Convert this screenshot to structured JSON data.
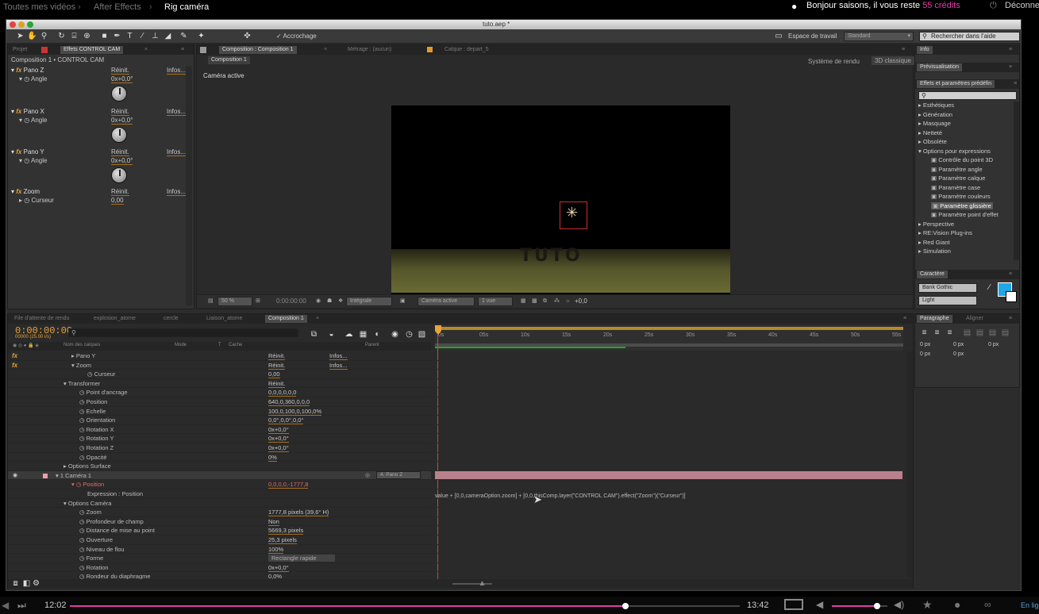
{
  "site": {
    "crumbs": [
      "Toutes mes vidéos",
      "After Effects",
      "Rig caméra"
    ],
    "greeting": "Bonjour saisons, il vous reste",
    "credits": "55 crédits",
    "disconnect": "Déconne"
  },
  "window": {
    "title": "tuto.aep *"
  },
  "toolbar": {
    "snap_label": "Accrochage",
    "workspace_label": "Espace de travail",
    "workspace_value": "Standard",
    "help_search": "Rechercher dans l'aide"
  },
  "left_panel": {
    "tabs": [
      "Projet",
      "Effets CONTROL CAM",
      "Métrage : (aucun)"
    ],
    "header": "Composition 1 • CONTROL CAM",
    "reset": "Réinit.",
    "about": "Infos...",
    "effects": [
      {
        "name": "Pano Z",
        "param": "Angle",
        "value": "0x+0,0°"
      },
      {
        "name": "Pano X",
        "param": "Angle",
        "value": "0x+0,0°"
      },
      {
        "name": "Pano Y",
        "param": "Angle",
        "value": "0x+0,0°"
      },
      {
        "name": "Zoom",
        "param": "Curseur",
        "value": "0,00"
      }
    ]
  },
  "comp_panel": {
    "tab": "Composition : Composition 1",
    "tab_metrage": "Métrage : (aucun)",
    "tab_calque": "Calque : depart_5",
    "subtab": "Composition 1",
    "renderer_label": "Système de rendu",
    "renderer_value": "3D classique",
    "active_cam": "Caméra active",
    "tuto_text": "TUTO",
    "zoom_value": "50 %",
    "timecode": "0:00:00:00",
    "resolution": "Intégrale",
    "camera": "Caméra active",
    "views": "1 vue",
    "exposure": "+0,0"
  },
  "right_panel": {
    "info_tab": "Info",
    "preview_tab": "Prévisualisation",
    "effects_tab": "Effets et paramètres prédéfin",
    "effects_list": [
      {
        "label": "Esthétiques",
        "level": 0
      },
      {
        "label": "Génération",
        "level": 0
      },
      {
        "label": "Masquage",
        "level": 0
      },
      {
        "label": "Netteté",
        "level": 0
      },
      {
        "label": "Obsolète",
        "level": 0
      },
      {
        "label": "Options pour expressions",
        "level": 0,
        "open": true
      },
      {
        "label": "Contrôle du point 3D",
        "level": 1
      },
      {
        "label": "Paramètre angle",
        "level": 1
      },
      {
        "label": "Paramètre calque",
        "level": 1
      },
      {
        "label": "Paramètre case",
        "level": 1
      },
      {
        "label": "Paramètre couleurs",
        "level": 1
      },
      {
        "label": "Paramètre glissière",
        "level": 1,
        "selected": true
      },
      {
        "label": "Paramètre point d'effet",
        "level": 1
      },
      {
        "label": "Perspective",
        "level": 0
      },
      {
        "label": "RE:Vision Plug-ins",
        "level": 0
      },
      {
        "label": "Red Giant",
        "level": 0
      },
      {
        "label": "Simulation",
        "level": 0
      }
    ],
    "char_tab": "Caractère",
    "font_name": "Bank Gothic",
    "font_style": "Light",
    "para_tab": "Paragraphe",
    "align_tab": "Aligner",
    "para_vals": [
      "0 px",
      "0 px",
      "0 px",
      "0 px",
      "0 px"
    ],
    "accent_color": "#1fa7e6"
  },
  "timeline": {
    "tabs": [
      "File d'attente de rendu",
      "explosion_atome",
      "cercle",
      "Liaison_atome",
      "Composition 1"
    ],
    "timecode": "0:00:00:00",
    "fps": "00000 (25.00 i/s)",
    "col_name": "Nom des calques",
    "col_mode": "Mode",
    "col_t": "T",
    "col_cache": "Cache",
    "col_parent": "Parent",
    "ruler": [
      "0s",
      "05s",
      "10s",
      "15s",
      "20s",
      "25s",
      "30s",
      "35s",
      "40s",
      "45s",
      "50s",
      "55s"
    ],
    "rows": [
      {
        "indent": 1,
        "label": "Pano Y",
        "value": "Réinit.",
        "extra": "Infos...",
        "fx": true
      },
      {
        "indent": 1,
        "label": "Zoom",
        "value": "Réinit.",
        "extra": "Infos...",
        "fx": true,
        "open": true
      },
      {
        "indent": 3,
        "label": "Curseur",
        "value": "0,00",
        "sw": true
      },
      {
        "indent": 0,
        "label": "Transformer",
        "value": "Réinit.",
        "open": true
      },
      {
        "indent": 2,
        "label": "Point d'ancrage",
        "value": "0,0,0,0,0,0",
        "sw": true
      },
      {
        "indent": 2,
        "label": "Position",
        "value": "640,0,360,0,0,0",
        "sw": true
      },
      {
        "indent": 2,
        "label": "Echelle",
        "value": "100,0,100,0,100,0%",
        "sw": true
      },
      {
        "indent": 2,
        "label": "Orientation",
        "value": "0,0°,0,0°,0,0°",
        "sw": true
      },
      {
        "indent": 2,
        "label": "Rotation X",
        "value": "0x+0,0°",
        "sw": true
      },
      {
        "indent": 2,
        "label": "Rotation Y",
        "value": "0x+0,0°",
        "sw": true
      },
      {
        "indent": 2,
        "label": "Rotation Z",
        "value": "0x+0,0°",
        "sw": true
      },
      {
        "indent": 2,
        "label": "Opacité",
        "value": "0%",
        "sw": true
      },
      {
        "indent": 0,
        "label": "Options Surface",
        "value": ""
      },
      {
        "indent": -1,
        "label": "1  Caméra 1",
        "value": "",
        "parent": "4. Pano Z",
        "layer": true
      },
      {
        "indent": 1,
        "label": "Position",
        "value": "0,0,0,0,-1777,8",
        "sw": true,
        "red": true,
        "open": true
      },
      {
        "indent": 3,
        "label": "Expression : Position",
        "value": ""
      },
      {
        "indent": 0,
        "label": "Options Caméra",
        "value": "",
        "open": true
      },
      {
        "indent": 2,
        "label": "Zoom",
        "value": "1777,8 pixels (39,6° H)",
        "sw": true
      },
      {
        "indent": 2,
        "label": "Profondeur de champ",
        "value": "Non",
        "sw": true
      },
      {
        "indent": 2,
        "label": "Distance de mise au point",
        "value": "5669,3 pixels",
        "sw": true
      },
      {
        "indent": 2,
        "label": "Ouverture",
        "value": "25,3 pixels",
        "sw": true
      },
      {
        "indent": 2,
        "label": "Niveau de flou",
        "value": "100%",
        "sw": true
      },
      {
        "indent": 2,
        "label": "Forme",
        "value": "Rectangle rapide",
        "sw": true,
        "dropdown": true
      },
      {
        "indent": 2,
        "label": "Rotation",
        "value": "0x+0,0°",
        "sw": true
      },
      {
        "indent": 2,
        "label": "Rondeur du diaphragme",
        "value": "0,0%",
        "sw": true
      }
    ],
    "expression": "value + [0,0,cameraOption.zoom] + [0,0,thisComp.layer(\"CONTROL CAM\").effect(\"Zoom\")(\"Curseur\")]"
  },
  "player": {
    "current_time": "12:02",
    "total_time": "13:42",
    "progress": 0.829,
    "volume": 0.82,
    "online": "En lig"
  }
}
